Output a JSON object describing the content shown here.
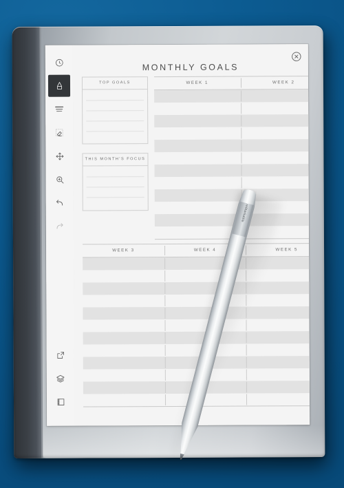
{
  "device": {
    "brand": "reMarkable",
    "stylus_brand": "reMarkable"
  },
  "toolbar": {
    "items": [
      {
        "name": "history-clock-icon",
        "label": "History",
        "selected": false,
        "dim": false
      },
      {
        "name": "pen-icon",
        "label": "Pen",
        "selected": true,
        "dim": false
      },
      {
        "name": "layers-lines-icon",
        "label": "Eraser Menu",
        "selected": false,
        "dim": false
      },
      {
        "name": "eraser-icon",
        "label": "Eraser",
        "selected": false,
        "dim": false
      },
      {
        "name": "move-selection-icon",
        "label": "Move",
        "selected": false,
        "dim": false
      },
      {
        "name": "zoom-in-icon",
        "label": "Zoom",
        "selected": false,
        "dim": false
      },
      {
        "name": "undo-icon",
        "label": "Undo",
        "selected": false,
        "dim": false
      },
      {
        "name": "redo-icon",
        "label": "Redo",
        "selected": false,
        "dim": true
      }
    ],
    "bottom_items": [
      {
        "name": "share-export-icon",
        "label": "Share"
      },
      {
        "name": "layers-icon",
        "label": "Layers"
      },
      {
        "name": "page-icon",
        "label": "Page"
      }
    ]
  },
  "page": {
    "title": "MONTHLY GOALS",
    "close_label": "Close",
    "panels": [
      {
        "title": "TOP GOALS",
        "lines": 5
      },
      {
        "title": "THIS MONTH'S FOCUS",
        "lines": 4
      }
    ],
    "tables": [
      {
        "id": "weeks-1-2",
        "headers": [
          "WEEK 1",
          "WEEK 2"
        ],
        "rows": 12
      },
      {
        "id": "weeks-3-5",
        "headers": [
          "WEEK 3",
          "WEEK 4",
          "WEEK 5"
        ],
        "rows": 12
      }
    ]
  },
  "colors": {
    "backdrop_blue": "#0b5d92",
    "screen_bg": "#f2f2f2",
    "toolbar_bg": "#f5f5f5",
    "selected_tool_bg": "#333639",
    "row_stripe": "#e2e2e2",
    "rule": "#c9c9c9",
    "text": "#6d6d6d"
  }
}
